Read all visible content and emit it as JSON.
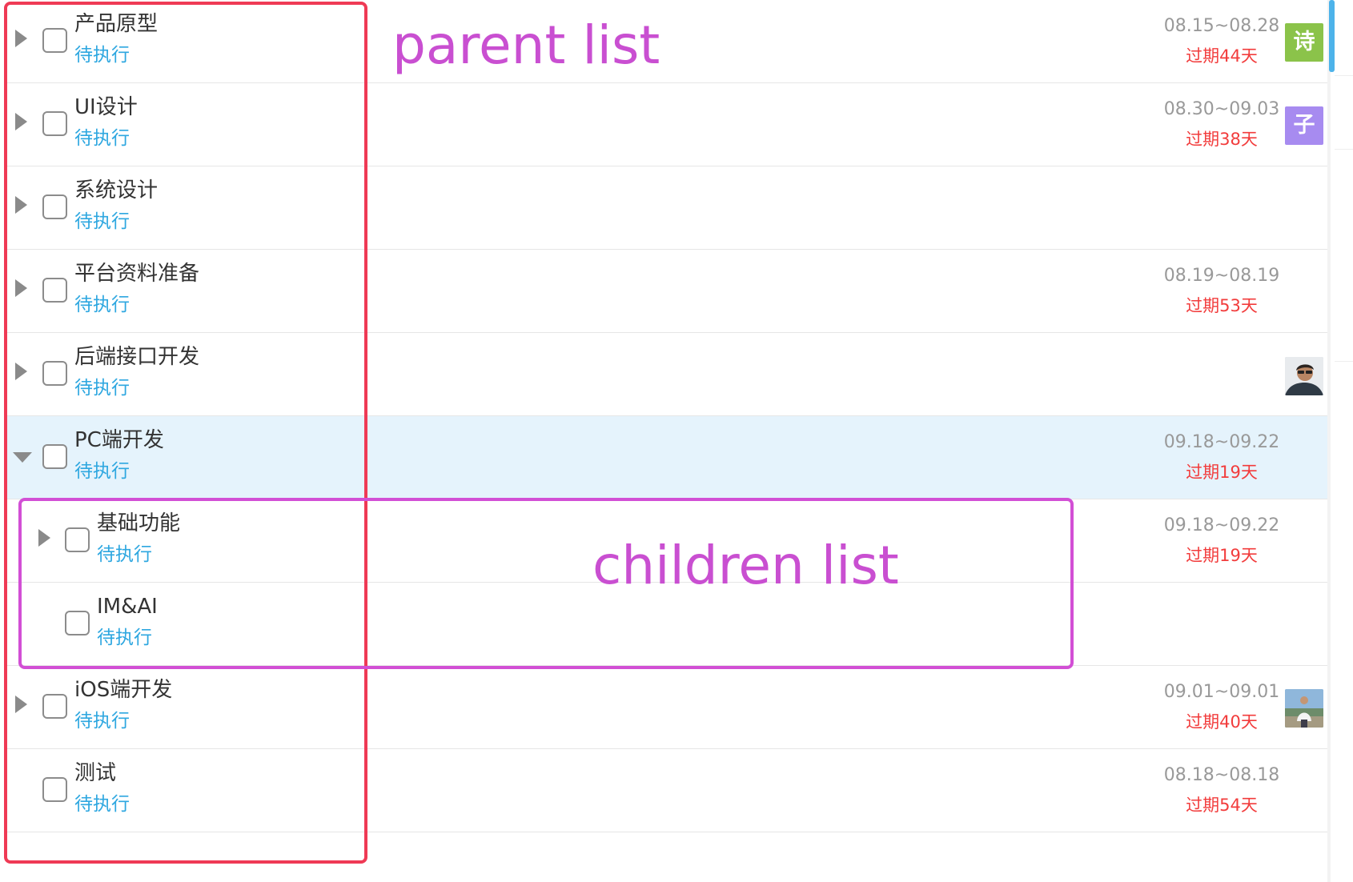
{
  "tasks": [
    {
      "title": "产品原型",
      "status": "待执行",
      "date_range": "08.15~08.28",
      "overdue": "过期44天",
      "avatar": "诗"
    },
    {
      "title": "UI设计",
      "status": "待执行",
      "date_range": "08.30~09.03",
      "overdue": "过期38天",
      "avatar": "子"
    },
    {
      "title": "系统设计",
      "status": "待执行"
    },
    {
      "title": "平台资料准备",
      "status": "待执行",
      "date_range": "08.19~08.19",
      "overdue": "过期53天"
    },
    {
      "title": "后端接口开发",
      "status": "待执行"
    },
    {
      "title": "PC端开发",
      "status": "待执行",
      "date_range": "09.18~09.22",
      "overdue": "过期19天"
    },
    {
      "title": "基础功能",
      "status": "待执行",
      "date_range": "09.18~09.22",
      "overdue": "过期19天"
    },
    {
      "title": "IM&AI",
      "status": "待执行"
    },
    {
      "title": "iOS端开发",
      "status": "待执行",
      "date_range": "09.01~09.01",
      "overdue": "过期40天"
    },
    {
      "title": "测试",
      "status": "待执行",
      "date_range": "08.18~08.18",
      "overdue": "过期54天"
    }
  ],
  "annotations": {
    "parent_list": "parent list",
    "children_list": "children list"
  },
  "colors": {
    "status": "#2ea7e0",
    "overdue": "#f23c3c",
    "date": "#999999",
    "selected_row": "#e5f3fc",
    "avatar_poem": "#8bc34a",
    "avatar_zi": "#a78bf0",
    "annotation_parent_box": "#ef3a55",
    "annotation_children_box": "#d24fd5",
    "annotation_text": "#c94fd1",
    "scroll_thumb": "#4db3ea"
  },
  "icons": {
    "collapsed": "triangle-right-icon",
    "expanded": "triangle-down-icon",
    "checkbox": "checkbox-icon",
    "photo_avatar": "user-photo-avatar"
  }
}
